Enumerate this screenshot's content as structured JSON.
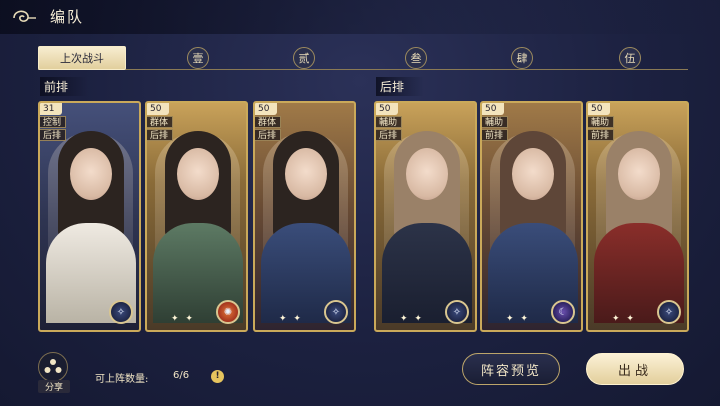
{
  "header": {
    "title": "编队",
    "back_icon": "back-swirl-icon"
  },
  "tabs": [
    {
      "label": "上次战斗",
      "active": true
    },
    {
      "label": "壹",
      "active": false
    },
    {
      "label": "贰",
      "active": false
    },
    {
      "label": "叁",
      "active": false
    },
    {
      "label": "肆",
      "active": false
    },
    {
      "label": "伍",
      "active": false
    }
  ],
  "rows": {
    "front": "前排",
    "back": "后排"
  },
  "cards": [
    {
      "level": "31",
      "tags": [
        "控制",
        "后排"
      ],
      "badge": "star-emblem-icon",
      "sparkles": ""
    },
    {
      "level": "50",
      "tags": [
        "群体",
        "后排"
      ],
      "badge": "fire-emblem-icon",
      "sparkles": "✦ ✦"
    },
    {
      "level": "50",
      "tags": [
        "群体",
        "后排"
      ],
      "badge": "star-emblem-icon",
      "sparkles": "✦ ✦"
    },
    {
      "level": "50",
      "tags": [
        "輔助",
        "后排"
      ],
      "badge": "star-emblem-icon",
      "sparkles": "✦ ✦"
    },
    {
      "level": "50",
      "tags": [
        "輔助",
        "前排"
      ],
      "badge": "moon-emblem-icon",
      "sparkles": "✦ ✦"
    },
    {
      "level": "50",
      "tags": [
        "輔助",
        "前排"
      ],
      "badge": "star-emblem-icon",
      "sparkles": "✦ ✦"
    }
  ],
  "footer": {
    "share_label": "分享",
    "deploy_count_label": "可上阵数量:",
    "deploy_count_value": "6/6",
    "info_icon": "!",
    "preview_label": "阵容预览",
    "battle_label": "出战"
  }
}
